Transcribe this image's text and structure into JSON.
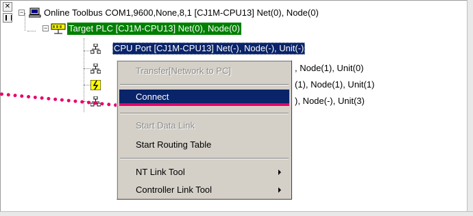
{
  "tree": {
    "root": {
      "label": "Online Toolbus COM1,9600,None,8,1 [CJ1M-CPU13] Net(0), Node(0)",
      "icon": "computer-icon"
    },
    "plc": {
      "label": "Target PLC [CJ1M-CPU13] Net(0), Node(0)",
      "icon": "plc-icon"
    },
    "children": [
      {
        "label": "CPU Port [CJ1M-CPU13] Net(-), Node(-), Unit(-)",
        "icon": "network-port-icon"
      },
      {
        "label": ", Node(1), Unit(0)",
        "icon": "network-port-icon"
      },
      {
        "label": "(1), Node(1), Unit(1)",
        "icon": "network-port-warning-icon"
      },
      {
        "label": "), Node(-), Unit(3)",
        "icon": "network-port-icon"
      }
    ]
  },
  "context_menu": {
    "items": [
      {
        "label": "Transfer[Network to PC]",
        "enabled": false
      },
      {
        "label": "Connect",
        "enabled": true,
        "highlighted": true
      },
      {
        "label": "Start Data Link",
        "enabled": false
      },
      {
        "label": "Start Routing Table",
        "enabled": true
      },
      {
        "label": "NT Link Tool",
        "enabled": true,
        "submenu": true
      },
      {
        "label": "Controller Link Tool",
        "enabled": true,
        "submenu": true
      }
    ]
  },
  "colors": {
    "plc_selection": "#008000",
    "port_selection": "#0a246a",
    "menu_highlight": "#0a246a",
    "drag_line": "#e8006a",
    "menu_background": "#d4d0c8"
  },
  "pane_buttons": {
    "close": "✕"
  }
}
